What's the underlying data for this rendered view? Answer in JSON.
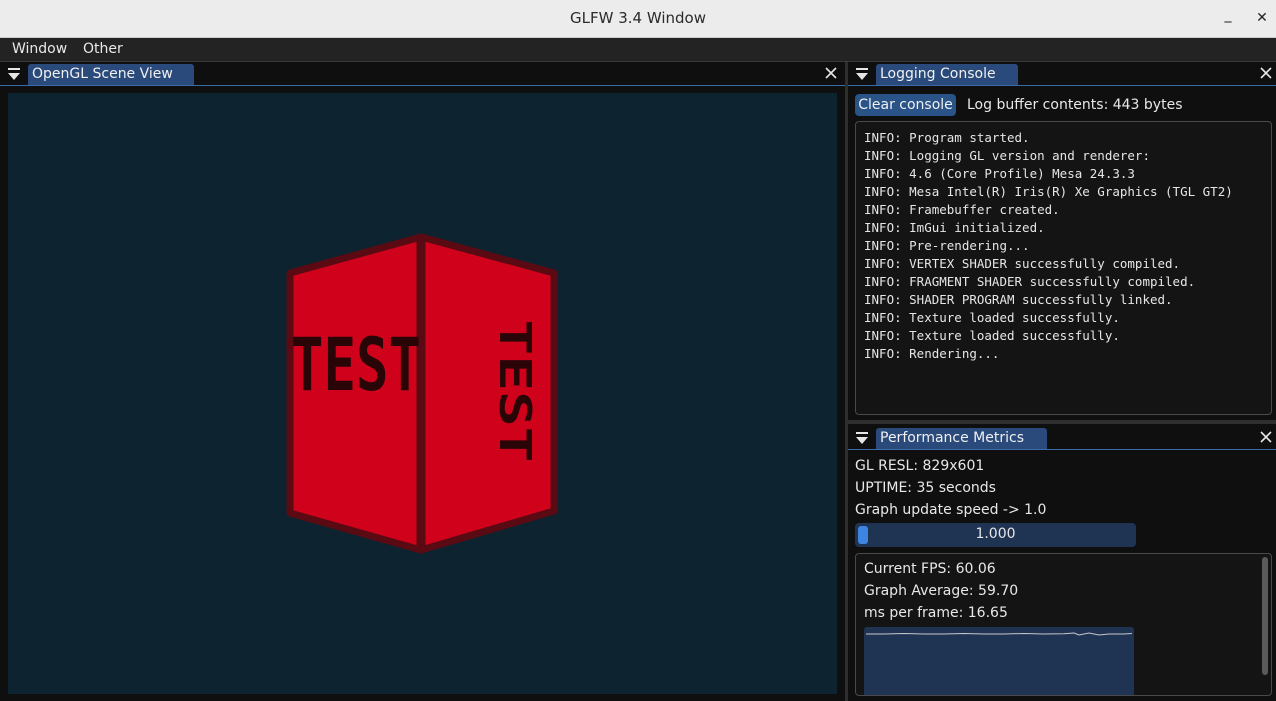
{
  "window": {
    "title": "GLFW 3.4 Window",
    "minimize_glyph": "_",
    "close_glyph": "✕"
  },
  "menu": {
    "items": [
      "Window",
      "Other"
    ]
  },
  "scene_panel": {
    "tab": "OpenGL Scene View",
    "cube_texture_text": "TEST"
  },
  "console_panel": {
    "tab": "Logging Console",
    "clear_label": "Clear console",
    "buffer_text": "Log buffer contents: 443 bytes",
    "lines": [
      "INFO: Program started.",
      "INFO: Logging GL version and renderer:",
      "INFO: 4.6 (Core Profile) Mesa 24.3.3",
      "INFO: Mesa Intel(R) Iris(R) Xe Graphics (TGL GT2)",
      "INFO: Framebuffer created.",
      "INFO: ImGui initialized.",
      "INFO: Pre-rendering...",
      "INFO: VERTEX SHADER successfully compiled.",
      "INFO: FRAGMENT SHADER successfully compiled.",
      "INFO: SHADER PROGRAM successfully linked.",
      "INFO: Texture loaded successfully.",
      "INFO: Texture loaded successfully.",
      "INFO: Rendering..."
    ]
  },
  "metrics_panel": {
    "tab": "Performance Metrics",
    "gl_resl": "GL RESL: 829x601",
    "uptime": "UPTIME: 35 seconds",
    "speed_label": "Graph update speed -> 1.0",
    "slider_value": "1.000",
    "slider_fraction": 0.0,
    "fps": "Current FPS: 60.06",
    "avg": "Graph Average: 59.70",
    "ms": "ms per frame: 16.65"
  },
  "colors": {
    "accent": "#294a7a",
    "scene_bg": "#0d2330",
    "cube_face": "#d0021b",
    "cube_edge": "#5a0a12"
  }
}
